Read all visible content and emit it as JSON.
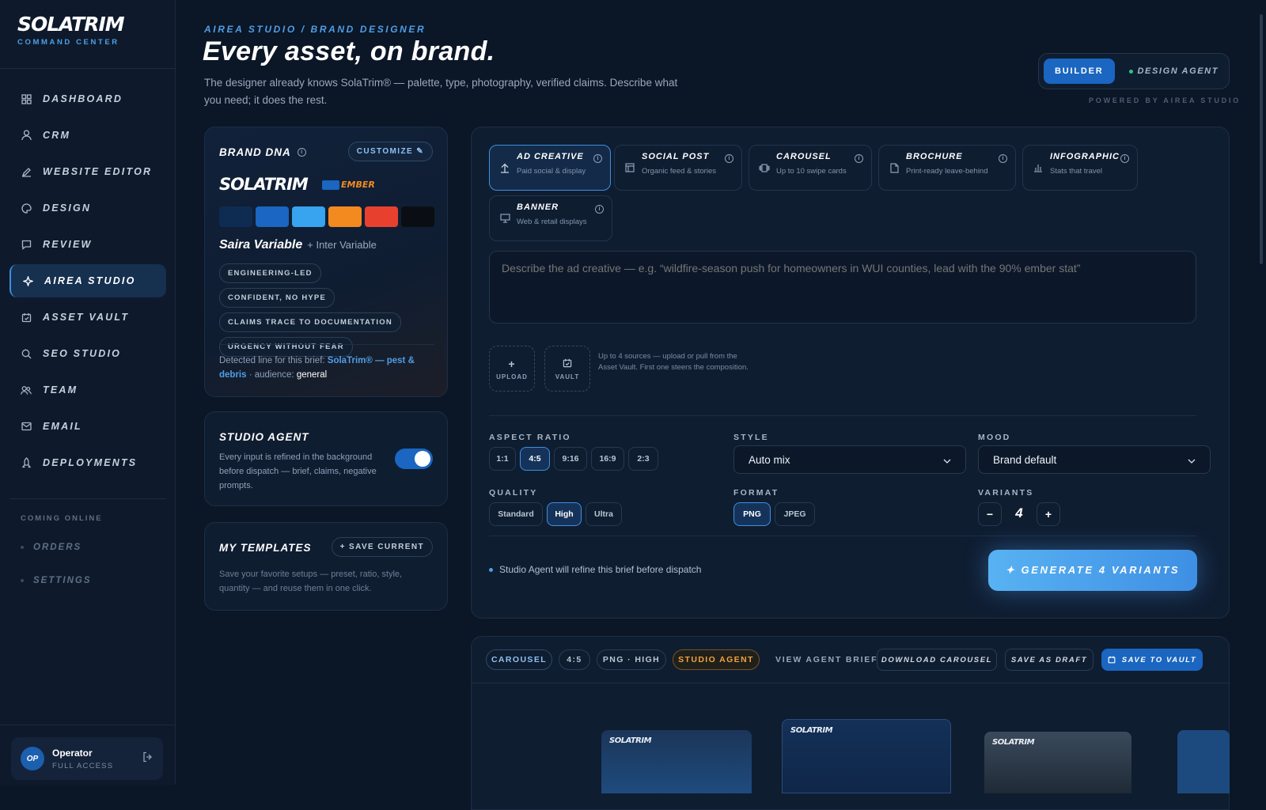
{
  "sidebar": {
    "logo": "SOLATRIM",
    "logo_sub": "COMMAND CENTER",
    "nav": [
      {
        "label": "DASHBOARD",
        "icon": "grid-icon"
      },
      {
        "label": "CRM",
        "icon": "user-icon"
      },
      {
        "label": "WEBSITE EDITOR",
        "icon": "pencil-icon"
      },
      {
        "label": "DESIGN",
        "icon": "palette-icon"
      },
      {
        "label": "REVIEW",
        "icon": "chat-icon"
      },
      {
        "label": "AIREA STUDIO",
        "icon": "sparkle-icon",
        "active": true
      },
      {
        "label": "ASSET VAULT",
        "icon": "vault-icon"
      },
      {
        "label": "SEO STUDIO",
        "icon": "search-icon"
      },
      {
        "label": "TEAM",
        "icon": "team-icon"
      },
      {
        "label": "EMAIL",
        "icon": "mail-icon"
      },
      {
        "label": "DEPLOYMENTS",
        "icon": "rocket-icon"
      }
    ],
    "coming_label": "COMING ONLINE",
    "coming": [
      "ORDERS",
      "SETTINGS"
    ],
    "operator": {
      "initials": "OP",
      "name": "Operator",
      "role": "FULL ACCESS"
    }
  },
  "header": {
    "breadcrumb": "AIREA STUDIO / BRAND DESIGNER",
    "title": "Every asset, on brand.",
    "lede": "The designer already knows SolaTrim® — palette, type, photography, verified claims. Describe what you need; it does the rest.",
    "mode_active": "BUILDER",
    "mode_alt": "DESIGN AGENT",
    "powered": "POWERED BY AIREA STUDIO"
  },
  "brand": {
    "title": "BRAND DNA",
    "customize": "CUSTOMIZE ✎",
    "logo": "SOLATRIM",
    "sub_logo": "EMBER",
    "colors": [
      "#0e2c52",
      "#1a66c0",
      "#38a3ee",
      "#f28a20",
      "#e8402f",
      "#0a0e14"
    ],
    "font_primary": "Saira Variable",
    "font_secondary": "+ Inter Variable",
    "tags": [
      "ENGINEERING-LED",
      "CONFIDENT, NO HYPE",
      "CLAIMS TRACE TO DOCUMENTATION",
      "URGENCY WITHOUT FEAR"
    ],
    "detected_prefix": "Detected line for this brief:",
    "detected_line": "SolaTrim® — pest & debris",
    "audience_prefix": "· audience:",
    "audience": "general"
  },
  "agent": {
    "title": "STUDIO AGENT",
    "desc": "Every input is refined in the background before dispatch — brief, claims, negative prompts.",
    "enabled": true
  },
  "templates": {
    "title": "MY TEMPLATES",
    "save": "+ SAVE CURRENT",
    "desc": "Save your favorite setups — preset, ratio, style, quantity — and reuse them in one click."
  },
  "types": [
    {
      "title": "AD CREATIVE",
      "sub": "Paid social & display",
      "icon": "upload-arrow-icon",
      "selected": true
    },
    {
      "title": "SOCIAL POST",
      "sub": "Organic feed & stories",
      "icon": "layout-icon"
    },
    {
      "title": "CAROUSEL",
      "sub": "Up to 10 swipe cards",
      "icon": "carousel-icon"
    },
    {
      "title": "BROCHURE",
      "sub": "Print-ready leave-behind",
      "icon": "document-icon"
    },
    {
      "title": "INFOGRAPHIC",
      "sub": "Stats that travel",
      "icon": "bar-chart-icon"
    },
    {
      "title": "BANNER",
      "sub": "Web & retail displays",
      "icon": "monitor-icon"
    }
  ],
  "brief_placeholder": "Describe the ad creative — e.g. “wildfire-season push for homeowners in WUI counties, lead with the 90% ember stat”",
  "sources": {
    "upload": "UPLOAD",
    "vault": "VAULT",
    "note": "Up to 4 sources — upload or pull from the Asset Vault. First one steers the composition."
  },
  "settings": {
    "aspect_label": "ASPECT RATIO",
    "aspects": [
      "1:1",
      "4:5",
      "9:16",
      "16:9",
      "2:3"
    ],
    "aspect_selected": "4:5",
    "style_label": "STYLE",
    "style_value": "Auto mix",
    "mood_label": "MOOD",
    "mood_value": "Brand default",
    "quality_label": "QUALITY",
    "qualities": [
      "Standard",
      "High",
      "Ultra"
    ],
    "quality_selected": "High",
    "format_label": "FORMAT",
    "formats": [
      "PNG",
      "JPEG"
    ],
    "format_selected": "PNG",
    "variants_label": "VARIANTS",
    "variants": "4",
    "minus": "−",
    "plus": "+"
  },
  "footer": {
    "refine": "Studio Agent will refine this brief before dispatch",
    "generate": "✦ GENERATE 4 VARIANTS"
  },
  "results": {
    "chips": [
      "CAROUSEL",
      "4:5",
      "PNG · HIGH",
      "STUDIO AGENT"
    ],
    "view_brief": "VIEW AGENT BRIEF",
    "download": "DOWNLOAD CAROUSEL",
    "draft": "SAVE AS DRAFT",
    "vault": "SAVE TO VAULT",
    "thumb_logo": "SOLATRIM"
  }
}
